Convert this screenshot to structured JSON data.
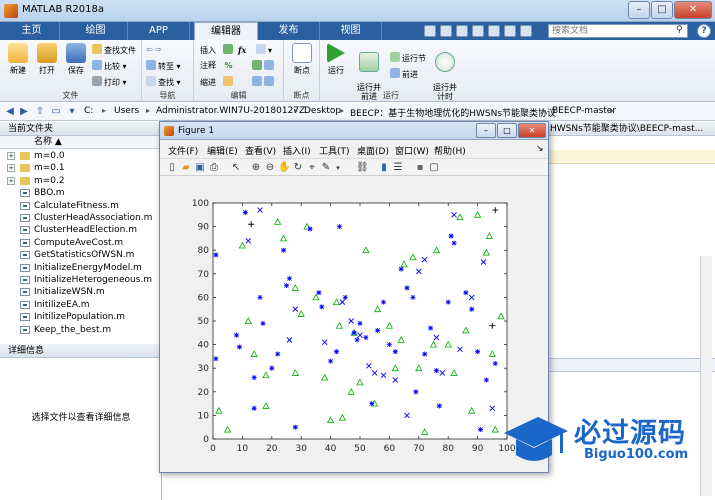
{
  "window": {
    "title": "MATLAB R2018a",
    "min": "–",
    "max": "□",
    "close": "✕"
  },
  "tabs": [
    {
      "label": "主页"
    },
    {
      "label": "绘图"
    },
    {
      "label": "APP"
    },
    {
      "label": "编辑器"
    },
    {
      "label": "发布"
    },
    {
      "label": "视图"
    }
  ],
  "search": {
    "placeholder": "搜索文档",
    "help": "?"
  },
  "ribbon": {
    "file_group": "文件",
    "new": "新建",
    "open": "打开",
    "save": "保存",
    "find_files": "查找文件",
    "compare": "比较",
    "print": "打印",
    "nav_group": "导航",
    "goto": "转至",
    "find": "查找",
    "edit_group": "编辑",
    "insert": "插入",
    "comment": "注释",
    "indent": "缩进",
    "fx": "fx",
    "breakpoint_group": "断点",
    "breakpoint": "断点",
    "run_group": "运行",
    "run": "运行",
    "run_advance": "运行并\n前进",
    "run_section": "运行节",
    "advance": "前进",
    "run_time": "运行并\n计时"
  },
  "addressbar": {
    "crumbs": [
      "C:",
      "Users",
      "Administrator.WIN7U-20180127Z",
      "Desktop",
      "BEECP：基于生物地理优化的HWSNs节能聚类协议",
      "BEECP-master"
    ]
  },
  "leftpanel": {
    "header": "当前文件夹",
    "col_name": "名称 ▲",
    "files": [
      {
        "name": "m=0.0",
        "type": "folder"
      },
      {
        "name": "m=0.1",
        "type": "folder"
      },
      {
        "name": "m=0.2",
        "type": "folder"
      },
      {
        "name": "BBO.m",
        "type": "m"
      },
      {
        "name": "CalculateFitness.m",
        "type": "m"
      },
      {
        "name": "ClusterHeadAssociation.m",
        "type": "m"
      },
      {
        "name": "ClusterHeadElection.m",
        "type": "m"
      },
      {
        "name": "ComputeAveCost.m",
        "type": "m"
      },
      {
        "name": "GetStatisticsOfWSN.m",
        "type": "m"
      },
      {
        "name": "InitializeEnergyModel.m",
        "type": "m"
      },
      {
        "name": "InitializeHeterogeneous.m",
        "type": "m"
      },
      {
        "name": "InitializeWSN.m",
        "type": "m"
      },
      {
        "name": "InitilizeEA.m",
        "type": "m"
      },
      {
        "name": "InitilizePopulation.m",
        "type": "m"
      },
      {
        "name": "Keep_the_best.m",
        "type": "m"
      }
    ],
    "details_header": "详细信息",
    "details_text": "选择文件以查看详细信息"
  },
  "rightpanel": {
    "header": "HWSNs节能聚类协议\\BEECP-mast..."
  },
  "figure": {
    "title": "Figure 1",
    "menus": [
      "文件(F)",
      "编辑(E)",
      "查看(V)",
      "插入(I)",
      "工具(T)",
      "桌面(D)",
      "窗口(W)",
      "帮助(H)"
    ]
  },
  "watermark": {
    "text": "必过源码",
    "url": "Biguo100.com"
  },
  "colors": {
    "accent": "#2a5fa0",
    "normal_node": "#00b000",
    "advanced_node": "#0000ff",
    "super_node": "#000000"
  },
  "chart_data": {
    "type": "scatter",
    "xlim": [
      0,
      100
    ],
    "ylim": [
      0,
      100
    ],
    "xticks": [
      0,
      10,
      20,
      30,
      40,
      50,
      60,
      70,
      80,
      90,
      100
    ],
    "yticks": [
      0,
      10,
      20,
      30,
      40,
      50,
      60,
      70,
      80,
      90,
      100
    ],
    "grid": false,
    "series": [
      {
        "marker": "triangle",
        "color": "#00b000",
        "points": [
          [
            2,
            12
          ],
          [
            5,
            4
          ],
          [
            10,
            82
          ],
          [
            12,
            50
          ],
          [
            14,
            36
          ],
          [
            18,
            27
          ],
          [
            22,
            92
          ],
          [
            24,
            85
          ],
          [
            28,
            28
          ],
          [
            28,
            64
          ],
          [
            30,
            53
          ],
          [
            32,
            90
          ],
          [
            35,
            60
          ],
          [
            38,
            26
          ],
          [
            40,
            8
          ],
          [
            42,
            58
          ],
          [
            43,
            48
          ],
          [
            44,
            9
          ],
          [
            47,
            20
          ],
          [
            48,
            45
          ],
          [
            50,
            24
          ],
          [
            52,
            80
          ],
          [
            55,
            15
          ],
          [
            56,
            55
          ],
          [
            60,
            48
          ],
          [
            62,
            30
          ],
          [
            64,
            42
          ],
          [
            65,
            74
          ],
          [
            68,
            77
          ],
          [
            70,
            30
          ],
          [
            72,
            3
          ],
          [
            75,
            40
          ],
          [
            76,
            80
          ],
          [
            80,
            40
          ],
          [
            82,
            28
          ],
          [
            84,
            94
          ],
          [
            86,
            46
          ],
          [
            88,
            12
          ],
          [
            90,
            95
          ],
          [
            93,
            79
          ],
          [
            94,
            86
          ],
          [
            95,
            36
          ],
          [
            96,
            4
          ],
          [
            98,
            52
          ],
          [
            18,
            14
          ]
        ]
      },
      {
        "marker": "x",
        "color": "#0000ff",
        "points": [
          [
            12,
            84
          ],
          [
            16,
            97
          ],
          [
            26,
            42
          ],
          [
            28,
            55
          ],
          [
            38,
            41
          ],
          [
            44,
            58
          ],
          [
            47,
            50
          ],
          [
            50,
            44
          ],
          [
            53,
            31
          ],
          [
            55,
            28
          ],
          [
            58,
            27
          ],
          [
            62,
            25
          ],
          [
            66,
            10
          ],
          [
            70,
            71
          ],
          [
            72,
            76
          ],
          [
            76,
            43
          ],
          [
            78,
            28
          ],
          [
            82,
            95
          ],
          [
            84,
            38
          ],
          [
            88,
            60
          ],
          [
            92,
            75
          ],
          [
            95,
            13
          ]
        ]
      },
      {
        "marker": "asterisk",
        "color": "#0000ff",
        "points": [
          [
            1,
            78
          ],
          [
            1,
            34
          ],
          [
            8,
            44
          ],
          [
            9,
            39
          ],
          [
            11,
            96
          ],
          [
            14,
            26
          ],
          [
            14,
            13
          ],
          [
            16,
            60
          ],
          [
            17,
            49
          ],
          [
            20,
            30
          ],
          [
            22,
            36
          ],
          [
            24,
            80
          ],
          [
            25,
            65
          ],
          [
            26,
            68
          ],
          [
            28,
            5
          ],
          [
            33,
            89
          ],
          [
            36,
            62
          ],
          [
            37,
            56
          ],
          [
            40,
            33
          ],
          [
            42,
            37
          ],
          [
            43,
            90
          ],
          [
            45,
            60
          ],
          [
            48,
            45
          ],
          [
            49,
            42
          ],
          [
            50,
            49
          ],
          [
            52,
            43
          ],
          [
            54,
            15
          ],
          [
            56,
            46
          ],
          [
            58,
            58
          ],
          [
            60,
            40
          ],
          [
            62,
            37
          ],
          [
            64,
            72
          ],
          [
            66,
            64
          ],
          [
            68,
            60
          ],
          [
            69,
            20
          ],
          [
            72,
            36
          ],
          [
            74,
            47
          ],
          [
            76,
            29
          ],
          [
            77,
            14
          ],
          [
            80,
            58
          ],
          [
            81,
            86
          ],
          [
            82,
            83
          ],
          [
            86,
            62
          ],
          [
            88,
            55
          ],
          [
            90,
            37
          ],
          [
            91,
            4
          ],
          [
            93,
            25
          ],
          [
            96,
            32
          ]
        ]
      },
      {
        "marker": "plus",
        "color": "#000000",
        "points": [
          [
            13,
            91
          ],
          [
            95,
            48
          ],
          [
            96,
            97
          ]
        ]
      }
    ]
  }
}
